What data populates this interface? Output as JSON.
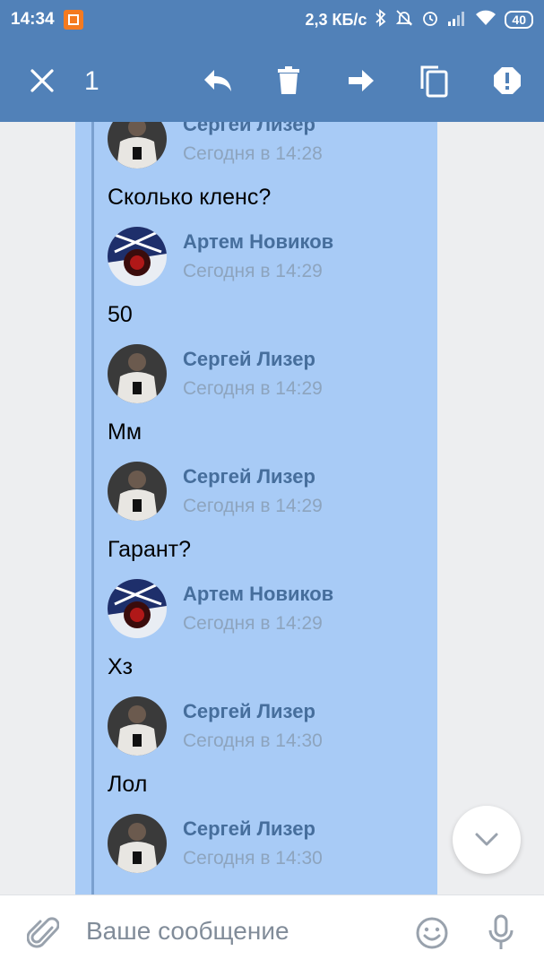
{
  "status_bar": {
    "time": "14:34",
    "net_speed": "2,3 КБ/с",
    "battery": "40"
  },
  "action_bar": {
    "selected_count": "1"
  },
  "messages": [
    {
      "author": "Сергей Лизер",
      "time": "Сегодня в 14:28",
      "text": "Сколько кленс?",
      "avatar": "sergey"
    },
    {
      "author": "Артем Новиков",
      "time": "Сегодня в 14:29",
      "text": "50",
      "avatar": "artem"
    },
    {
      "author": "Сергей Лизер",
      "time": "Сегодня в 14:29",
      "text": "Мм",
      "avatar": "sergey"
    },
    {
      "author": "Сергей Лизер",
      "time": "Сегодня в 14:29",
      "text": "Гарант?",
      "avatar": "sergey"
    },
    {
      "author": "Артем Новиков",
      "time": "Сегодня в 14:29",
      "text": "Хз",
      "avatar": "artem"
    },
    {
      "author": "Сергей Лизер",
      "time": "Сегодня в 14:30",
      "text": "Лол",
      "avatar": "sergey"
    },
    {
      "author": "Сергей Лизер",
      "time": "Сегодня в 14:30",
      "text": "",
      "avatar": "sergey"
    }
  ],
  "input": {
    "placeholder": "Ваше сообщение"
  },
  "colors": {
    "header": "#5181b8",
    "selection": "#a8cbf6",
    "author": "#466e9c"
  }
}
